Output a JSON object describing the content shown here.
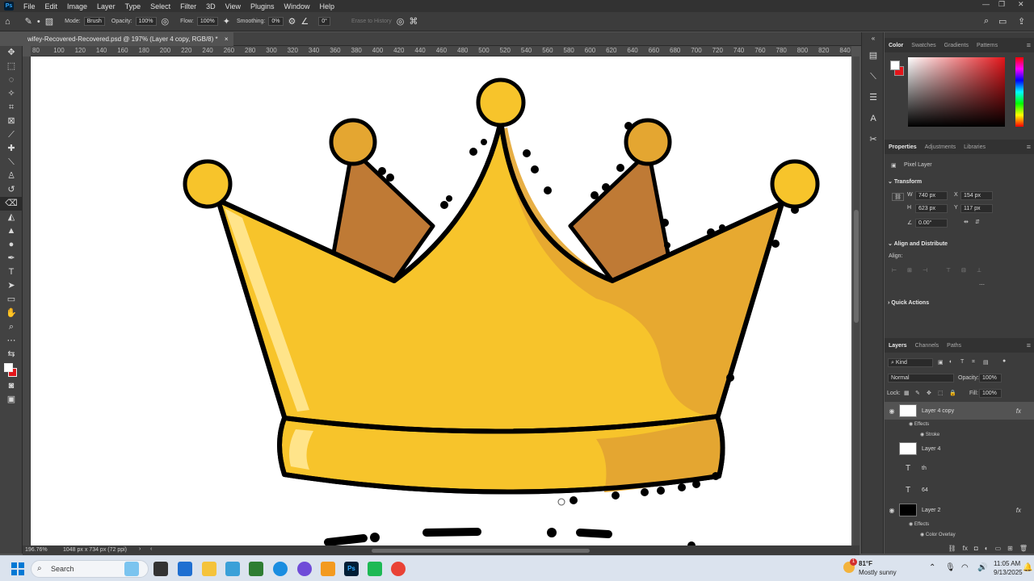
{
  "menubar": {
    "logo": "Ps",
    "items": [
      "File",
      "Edit",
      "Image",
      "Layer",
      "Type",
      "Select",
      "Filter",
      "3D",
      "View",
      "Plugins",
      "Window",
      "Help"
    ]
  },
  "options": {
    "mode_label": "Mode:",
    "mode_value": "Brush",
    "opacity_label": "Opacity:",
    "opacity_value": "100%",
    "flow_label": "Flow:",
    "flow_value": "100%",
    "smoothing_label": "Smoothing:",
    "smoothing_value": "0%",
    "angle_value": "0°",
    "erase_history": "Erase to History"
  },
  "document": {
    "tab_title": "wifey-Recovered-Recovered.psd @ 197% (Layer 4 copy, RGB/8) *",
    "zoom": "196.76%",
    "doc_info": "1048 px x 734 px (72 ppi)"
  },
  "ruler": {
    "ticks": [
      "80",
      "100",
      "120",
      "140",
      "160",
      "180",
      "200",
      "220",
      "240",
      "260",
      "280",
      "300",
      "320",
      "340",
      "360",
      "380",
      "400",
      "420",
      "440",
      "460",
      "480",
      "500",
      "520",
      "540",
      "560",
      "580",
      "600",
      "620",
      "640",
      "660",
      "680",
      "700",
      "720",
      "740",
      "760",
      "780",
      "800",
      "820",
      "840"
    ]
  },
  "color_panel": {
    "tabs": [
      "Color",
      "Swatches",
      "Gradients",
      "Patterns"
    ],
    "fg_color": "#ffffff",
    "bg_color": "#e3151a"
  },
  "properties": {
    "tabs": [
      "Properties",
      "Adjustments",
      "Libraries"
    ],
    "layer_kind": "Pixel Layer",
    "transform_title": "Transform",
    "w_label": "W",
    "w_value": "740 px",
    "h_label": "H",
    "h_value": "623 px",
    "x_label": "X",
    "x_value": "154 px",
    "y_label": "Y",
    "y_value": "117 px",
    "angle_value": "0.00°",
    "align_title": "Align and Distribute",
    "align_label": "Align:",
    "quick_actions": "Quick Actions"
  },
  "layers_panel": {
    "tabs": [
      "Layers",
      "Channels",
      "Paths"
    ],
    "kind_filter": "Kind",
    "blend_mode": "Normal",
    "opacity_label": "Opacity:",
    "opacity_value": "100%",
    "lock_label": "Lock:",
    "fill_label": "Fill:",
    "fill_value": "100%",
    "layers": [
      {
        "name": "Layer 4 copy",
        "fx": "fx"
      },
      {
        "name": "Layer 4"
      },
      {
        "name": "th"
      },
      {
        "name": "64"
      },
      {
        "name": "Layer 2",
        "fx": "fx"
      }
    ],
    "effects_label": "Effects",
    "stroke_label": "Stroke",
    "effects_label_2": "Effects",
    "color_overlay_label": "Color Overlay"
  },
  "taskbar": {
    "search_placeholder": "Search",
    "weather_temp": "81°F",
    "weather_desc": "Mostly sunny",
    "weather_badge": "1",
    "time": "11:05 AM",
    "date": "9/13/2025"
  },
  "palette": {
    "crown_main": "#f7c42b",
    "crown_shade": "#e4a631",
    "crown_back": "#bf7a35",
    "outline": "#000000",
    "accent": "#31a8ff"
  }
}
